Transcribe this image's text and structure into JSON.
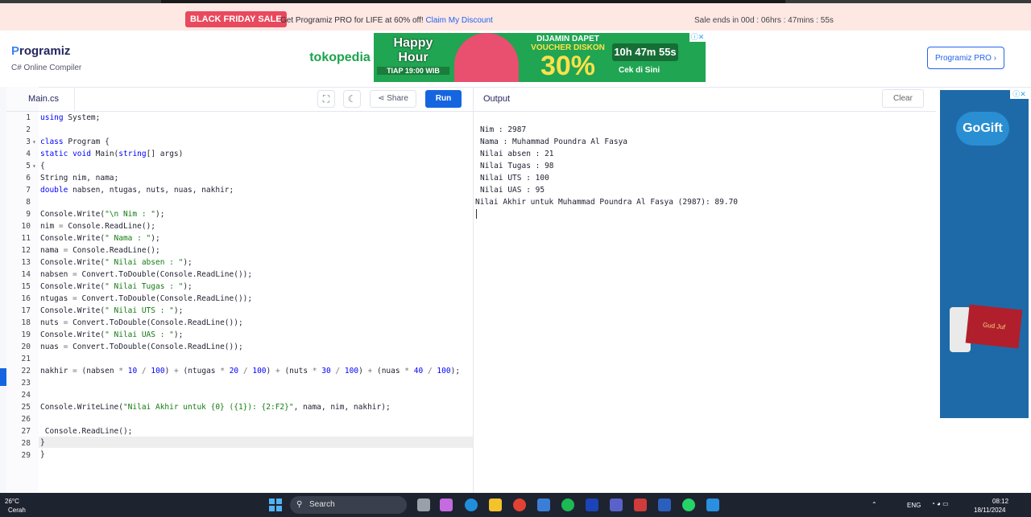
{
  "promo": {
    "badge": "BLACK FRIDAY SALE",
    "text": "Get Programiz PRO for LIFE at 60% off!",
    "link": "Claim My Discount",
    "sale_ends": "Sale ends in 00d : 06hrs : 47mins : 55s"
  },
  "header": {
    "logo": "rogramiz",
    "subtitle": "C# Online Compiler",
    "pro_button": "Programiz PRO ›",
    "ad": {
      "brand": "tokopedia",
      "happy": "Happy",
      "hour": "Hour",
      "time": "TIAP 19:00 WIB",
      "line1": "DIJAMIN DAPET",
      "line2": "VOUCHER DISKON",
      "percent": "30%",
      "timer": "10h 47m 55s",
      "cta": "Cek di Sini"
    }
  },
  "editor": {
    "tab": "Main.cs",
    "share": "Share",
    "run": "Run",
    "line_numbers": [
      "1",
      "2",
      "3",
      "4",
      "5",
      "6",
      "7",
      "8",
      "9",
      "10",
      "11",
      "12",
      "13",
      "14",
      "15",
      "16",
      "17",
      "18",
      "19",
      "20",
      "21",
      "22",
      "23",
      "24",
      "25",
      "26",
      "27",
      "28",
      "29"
    ]
  },
  "output": {
    "title": "Output",
    "clear": "Clear",
    "lines": [
      "Nim : 2987",
      "Nama : Muhammad Poundra Al Fasya",
      "Nilai absen : 21",
      "Nilai Tugas : 98",
      "Nilai UTS : 100",
      "Nilai UAS : 95",
      "Nilai Akhir untuk Muhammad Poundra Al Fasya (2987): 89.70"
    ]
  },
  "side_ad": {
    "brand": "GoGift",
    "card": "Gud Juf"
  },
  "taskbar": {
    "weather_temp": "26°C",
    "weather_text": "Cerah",
    "search": "Search",
    "lang": "ENG",
    "time": "08:12",
    "date": "18/11/2024"
  }
}
